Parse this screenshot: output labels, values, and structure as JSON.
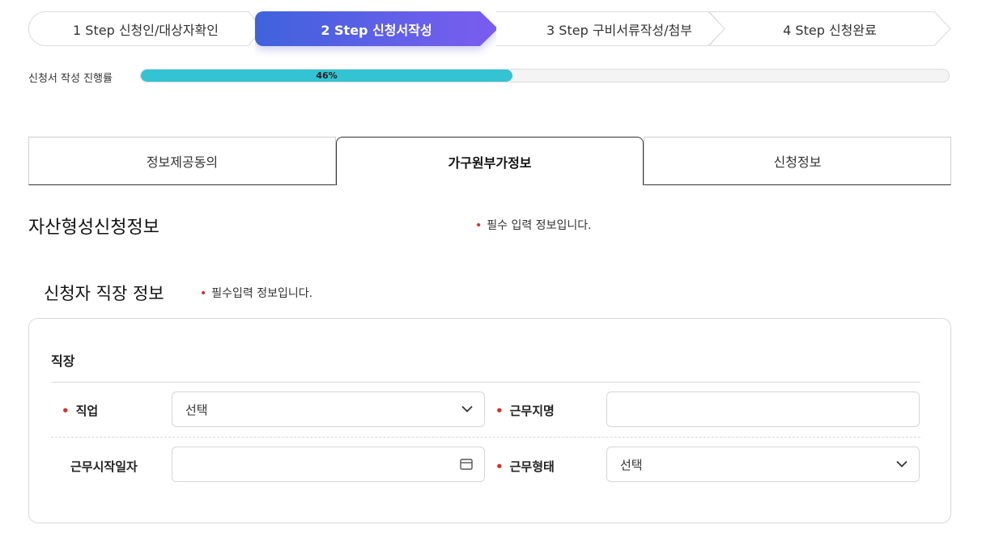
{
  "steps": [
    {
      "label": "1 Step 신청인/대상자확인"
    },
    {
      "label": "2 Step 신청서작성"
    },
    {
      "label": "3 Step 구비서류작성/첨부"
    },
    {
      "label": "4 Step 신청완료"
    }
  ],
  "progress": {
    "label": "신청서 작성 진행률",
    "value_text": "46%",
    "value": 46,
    "color": "#33c3d2"
  },
  "tabs": [
    {
      "label": "정보제공동의"
    },
    {
      "label": "가구원부가정보"
    },
    {
      "label": "신청정보"
    }
  ],
  "section": {
    "title": "자산형성신청정보",
    "required_note": "필수 입력 정보입니다."
  },
  "subsection": {
    "title": "신청자 직장 정보",
    "required_note": "필수입력 정보입니다."
  },
  "card": {
    "title": "직장",
    "fields": {
      "job": {
        "label": "직업",
        "value": "선택"
      },
      "workplace": {
        "label": "근무지명",
        "value": ""
      },
      "start_date": {
        "label": "근무시작일자",
        "value": ""
      },
      "work_type": {
        "label": "근무형태",
        "value": "선택"
      }
    }
  },
  "colors": {
    "accent_start": "#3f63dc",
    "accent_end": "#7b5cf0",
    "required": "#e02b2b"
  },
  "icons": {
    "dropdown": "chevron-down-icon",
    "calendar": "calendar-icon"
  }
}
